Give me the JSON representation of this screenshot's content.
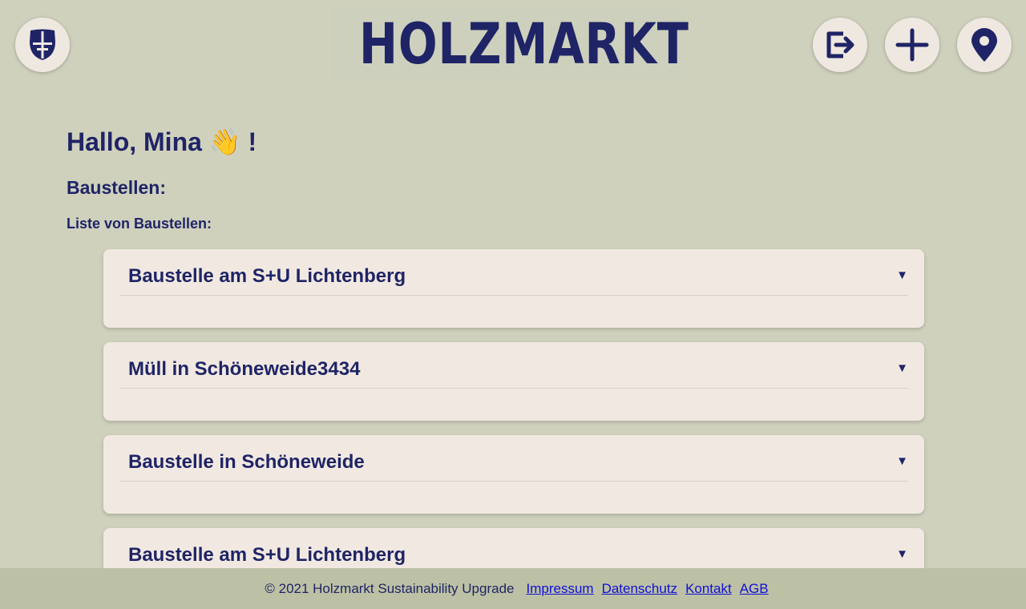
{
  "header": {
    "logo_text": "HOLZMARKT",
    "home_icon": "holzmarkt-mask-icon",
    "logout_icon": "logout-icon",
    "add_icon": "plus-icon",
    "map_icon": "location-pin-icon"
  },
  "main": {
    "greeting": "Hallo, Mina 👋 !",
    "section_title": "Baustellen:",
    "list_title": "Liste von Baustellen:",
    "cards": [
      {
        "title": "Baustelle am S+U Lichtenberg",
        "toggle": "▼"
      },
      {
        "title": "Müll in Schöneweide3434",
        "toggle": "▼"
      },
      {
        "title": "Baustelle in Schöneweide",
        "toggle": "▼"
      },
      {
        "title": "Baustelle am S+U Lichtenberg",
        "toggle": "▼"
      }
    ]
  },
  "footer": {
    "copyright": "© 2021 Holzmarkt Sustainability Upgrade",
    "links": [
      "Impressum",
      "Datenschutz",
      "Kontakt",
      "AGB"
    ]
  },
  "colors": {
    "background": "#cfd1bd",
    "navy": "#1f2466",
    "card": "#f1e9e1",
    "footer": "#bcc1a5",
    "link": "#1010d8"
  }
}
